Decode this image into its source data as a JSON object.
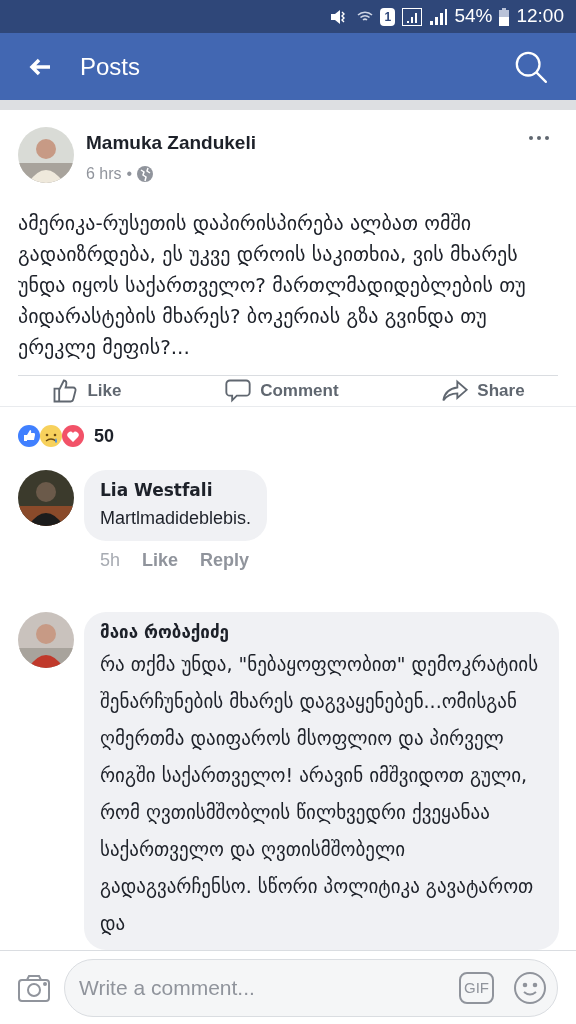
{
  "status_bar": {
    "sim_slot": "1",
    "battery": "54%",
    "time": "12:00"
  },
  "header": {
    "title": "Posts"
  },
  "post": {
    "author": "Mamuka Zandukeli",
    "time": "6 hrs",
    "separator": "•",
    "text": "ამერიკა-რუსეთის დაპირისპირება ალბათ ომში გადაიზრდება, ეს უკვე დროის საკითხია, ვის მხარეს უნდა იყოს საქართველო? მართლმადიდებლების თუ პიდარასტების მხარეს? ბოკერიას გზა გვინდა თუ ერეკლე მეფის?...",
    "actions": [
      {
        "kind": "like",
        "label": "Like"
      },
      {
        "kind": "comment",
        "label": "Comment"
      },
      {
        "kind": "share",
        "label": "Share"
      }
    ],
    "reaction_count": "50"
  },
  "comments": [
    {
      "author": "Lia Westfali",
      "text": "Martlmadideblebis.",
      "time": "5h",
      "actions": [
        "Like",
        "Reply"
      ]
    },
    {
      "author": "მაია რობაქიძე",
      "text": "რა თქმა უნდა, \"ნებაყოფლობით\" დემოკრატიის შენარჩუნების მხარეს დაგვაყენებენ...ომისგან ღმერთმა დაიფაროს მსოფლიო და პირველ რიგში საქართველო! არავინ იმშვიდოთ გული, რომ ღვთისმშობლის წილხვედრი ქვეყანაა საქართველო და ღვთისმშობელი გადაგვარჩენსო. სწორი პოლიტიკა გავატაროთ და"
    }
  ],
  "composer": {
    "placeholder": "Write a comment...",
    "gif": "GIF"
  }
}
